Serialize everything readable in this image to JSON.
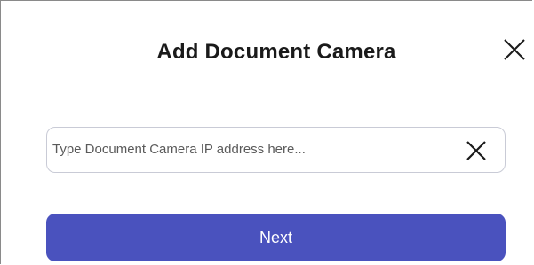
{
  "dialog": {
    "title": "Add Document Camera",
    "close_icon": "close-icon"
  },
  "ip_field": {
    "placeholder": "Type Document Camera IP address here...",
    "value": "",
    "clear_icon": "clear-icon"
  },
  "next_button": {
    "label": "Next"
  },
  "colors": {
    "accent": "#4a52be",
    "field_border": "#c9cbd6",
    "title_text": "#1a1a1a"
  }
}
